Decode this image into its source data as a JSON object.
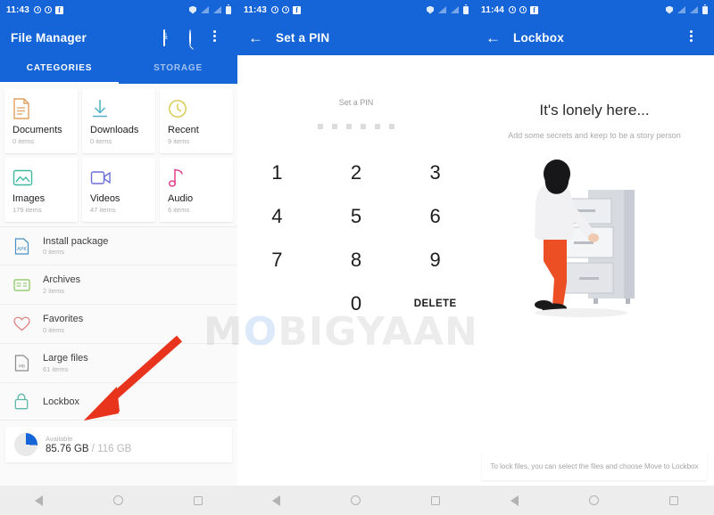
{
  "meta": {
    "watermark": "MOBIGYAAN"
  },
  "panel1": {
    "statusbar": {
      "time": "11:43",
      "icons": [
        "alarm-icon",
        "alarm-icon",
        "facebook-icon"
      ],
      "right_icons": [
        "shield-icon",
        "signal-off-icon",
        "signal-off-icon",
        "battery-icon"
      ]
    },
    "appbar": {
      "title": "File Manager",
      "actions": [
        "add-file-icon",
        "search-icon",
        "overflow-menu-icon"
      ]
    },
    "tabs": [
      {
        "label": "CATEGORIES",
        "active": true
      },
      {
        "label": "STORAGE",
        "active": false
      }
    ],
    "cards": [
      {
        "title": "Documents",
        "sub": "0 items",
        "icon": "document-icon",
        "color": "#E0A060"
      },
      {
        "title": "Downloads",
        "sub": "0 items",
        "icon": "download-icon",
        "color": "#4FB0C6"
      },
      {
        "title": "Recent",
        "sub": "9 items",
        "icon": "clock-icon",
        "color": "#D8C84A"
      },
      {
        "title": "Images",
        "sub": "179 items",
        "icon": "image-icon",
        "color": "#3FB8A0"
      },
      {
        "title": "Videos",
        "sub": "47 items",
        "icon": "video-icon",
        "color": "#6A6FD8"
      },
      {
        "title": "Audio",
        "sub": "6 items",
        "icon": "music-note-icon",
        "color": "#E0408A"
      }
    ],
    "rows": [
      {
        "title": "Install package",
        "sub": "0 items",
        "icon": "apk-icon",
        "color": "#4A90C4"
      },
      {
        "title": "Archives",
        "sub": "2 items",
        "icon": "archive-icon",
        "color": "#86C45A"
      },
      {
        "title": "Favorites",
        "sub": "0 items",
        "icon": "heart-icon",
        "color": "#E07A7A"
      },
      {
        "title": "Large files",
        "sub": "61 items",
        "icon": "large-file-icon",
        "color": "#8A8A8A"
      }
    ],
    "lockbox_row": {
      "title": "Lockbox",
      "icon": "lock-icon",
      "color": "#5BB8A8"
    },
    "storage": {
      "label": "Available",
      "used": "85.76 GB",
      "separator": "/",
      "total": "116 GB",
      "percent": 26
    },
    "navbar": [
      "back-icon",
      "home-icon",
      "recents-icon"
    ]
  },
  "panel2": {
    "statusbar": {
      "time": "11:43"
    },
    "appbar": {
      "title": "Set a PIN",
      "back": "back-arrow-icon"
    },
    "pin": {
      "label": "Set a PIN",
      "dots": 6,
      "keys": [
        "1",
        "2",
        "3",
        "4",
        "5",
        "6",
        "7",
        "8",
        "9",
        "",
        "0",
        "DELETE"
      ]
    },
    "navbar": [
      "back-icon",
      "home-icon",
      "recents-icon"
    ]
  },
  "panel3": {
    "statusbar": {
      "time": "11:44"
    },
    "appbar": {
      "title": "Lockbox",
      "back": "back-arrow-icon",
      "actions": [
        "overflow-menu-icon"
      ]
    },
    "empty": {
      "title": "It's lonely here...",
      "subtitle": "Add some secrets and keep to be a story person",
      "illustration": "person-at-filing-cabinet-illustration"
    },
    "hint": "To lock files, you can select the files and choose Move to Lockbox",
    "navbar": [
      "back-icon",
      "home-icon",
      "recents-icon"
    ]
  },
  "colors": {
    "brand_blue": "#1565D8",
    "annotation_red": "#E8341C",
    "page_bg": "#FAFAFA"
  }
}
